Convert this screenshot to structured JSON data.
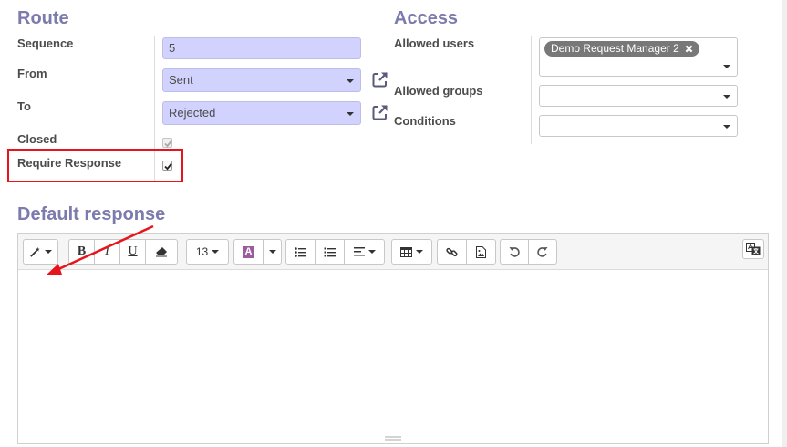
{
  "route": {
    "title": "Route",
    "sequence_label": "Sequence",
    "sequence_value": "5",
    "from_label": "From",
    "from_value": "Sent",
    "to_label": "To",
    "to_value": "Rejected",
    "closed_label": "Closed",
    "closed_checked": true,
    "require_response_label": "Require Response",
    "require_response_checked": true
  },
  "access": {
    "title": "Access",
    "allowed_users_label": "Allowed users",
    "allowed_users_tags": [
      "Demo Request Manager 2"
    ],
    "allowed_groups_label": "Allowed groups",
    "conditions_label": "Conditions"
  },
  "default_response": {
    "title": "Default response",
    "toolbar": {
      "font_size": "13",
      "bold_glyph": "B",
      "italic_glyph": "I",
      "underline_glyph": "U",
      "color_glyph": "A"
    }
  },
  "colors": {
    "section_title": "#7c7bad",
    "required_field_bg": "#d2d2ff",
    "highlight_border": "#e8141c",
    "tag_bg": "#787878",
    "annotation_arrow": "#e8141c"
  },
  "icons": {
    "external_link": "external-link-icon",
    "magic_wand": "magic-wand-icon",
    "eraser": "eraser-icon",
    "unordered_list": "unordered-list-icon",
    "ordered_list": "ordered-list-icon",
    "align": "align-icon",
    "table": "table-icon",
    "link": "link-icon",
    "image": "image-icon",
    "undo": "undo-icon",
    "redo": "redo-icon",
    "translate": "translate-icon",
    "tag_remove": "close-icon"
  }
}
